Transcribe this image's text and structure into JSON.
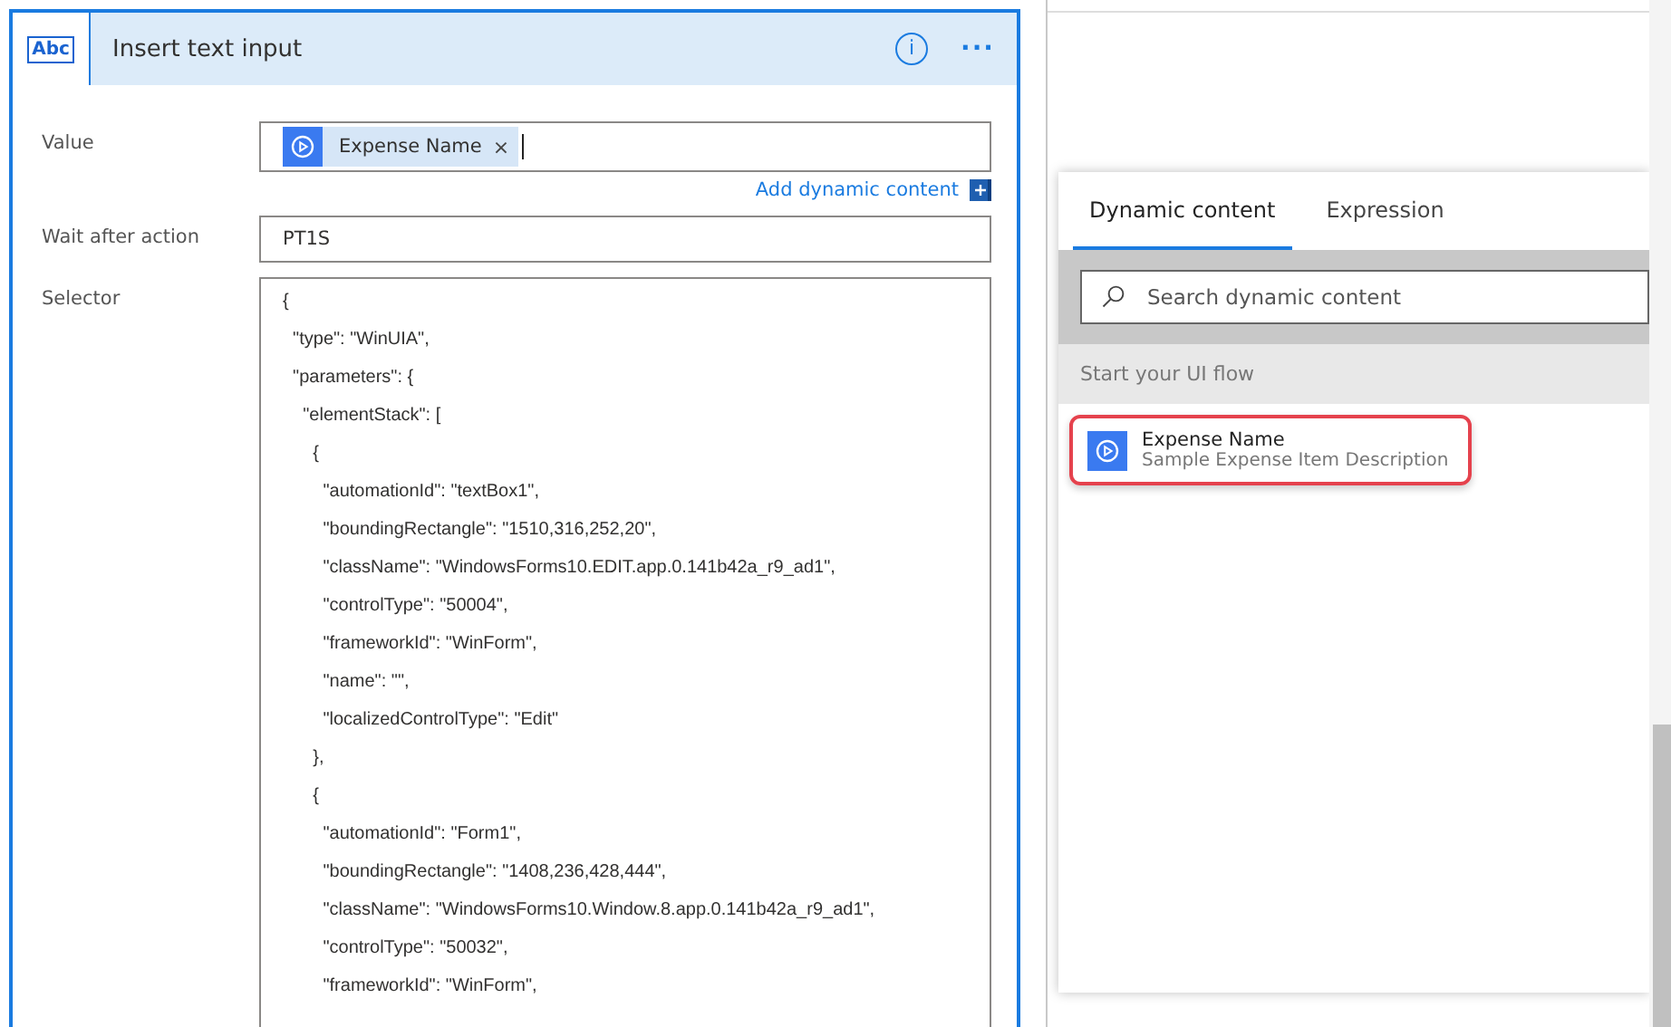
{
  "action_card": {
    "icon_text": "Abc",
    "title": "Insert text input",
    "info_icon": "i",
    "more_icon": "···",
    "fields": [
      {
        "kind": "tokens",
        "label": "Value",
        "tokens": [
          {
            "label": "Expense Name",
            "remove": "×"
          }
        ],
        "link": "Add dynamic content"
      },
      {
        "kind": "text",
        "label": "Wait after action",
        "value": "PT1S"
      },
      {
        "kind": "code",
        "label": "Selector",
        "lines": [
          "{",
          "  \"type\": \"WinUIA\",",
          "  \"parameters\": {",
          "    \"elementStack\": [",
          "      {",
          "        \"automationId\": \"textBox1\",",
          "        \"boundingRectangle\": \"1510,316,252,20\",",
          "        \"className\": \"WindowsForms10.EDIT.app.0.141b42a_r9_ad1\",",
          "        \"controlType\": \"50004\",",
          "        \"frameworkId\": \"WinForm\",",
          "        \"name\": \"\",",
          "        \"localizedControlType\": \"Edit\"",
          "      },",
          "      {",
          "        \"automationId\": \"Form1\",",
          "        \"boundingRectangle\": \"1408,236,428,444\",",
          "        \"className\": \"WindowsForms10.Window.8.app.0.141b42a_r9_ad1\",",
          "        \"controlType\": \"50032\",",
          "        \"frameworkId\": \"WinForm\","
        ]
      }
    ]
  },
  "dynamic_panel": {
    "tabs": [
      {
        "label": "Dynamic content",
        "selected": true
      },
      {
        "label": "Expression",
        "selected": false
      }
    ],
    "search": {
      "placeholder": "Search dynamic content"
    },
    "section": "Start your UI flow",
    "items": [
      {
        "name": "Expense Name",
        "description": "Sample Expense Item Description",
        "highlighted": true
      }
    ]
  }
}
